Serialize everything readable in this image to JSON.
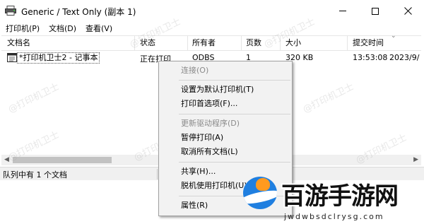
{
  "window": {
    "title": "Generic / Text Only (副本 1)"
  },
  "menubar": {
    "items": [
      "打印机(P)",
      "文档(D)",
      "查看(V)"
    ]
  },
  "columns": [
    "文档名",
    "状态",
    "所有者",
    "页数",
    "大小",
    "提交时间"
  ],
  "rows": [
    {
      "name": "*打印机卫士2 - 记事本",
      "status": "正在打印",
      "owner": "ODBS",
      "pages": "1",
      "size": "320 KB",
      "time": "13:53:08",
      "date": "2023/9/"
    }
  ],
  "statusbar": {
    "text": "队列中有 1 个文档"
  },
  "context_menu": {
    "items": [
      {
        "label": "连接(O)",
        "disabled": true
      },
      {
        "label": "设置为默认打印机(T)",
        "disabled": false
      },
      {
        "label": "打印首选项(F)...",
        "disabled": false
      },
      {
        "label": "更新驱动程序(D)",
        "disabled": true
      },
      {
        "label": "暂停打印(A)",
        "disabled": false
      },
      {
        "label": "取消所有文档(L)",
        "disabled": false
      },
      {
        "label": "共享(H)...",
        "disabled": false
      },
      {
        "label": "脱机使用打印机(U)",
        "disabled": false
      },
      {
        "label": "属性(R)",
        "disabled": false
      }
    ]
  },
  "watermark": "@打印机卫士",
  "logo": {
    "text": "百游手游网",
    "subtext": "jwdwbsdclrysg.com"
  },
  "colors": {
    "accent": "#1f7fe0",
    "disabled_text": "#8a8a8a",
    "menu_bg": "#f2f2f2"
  }
}
